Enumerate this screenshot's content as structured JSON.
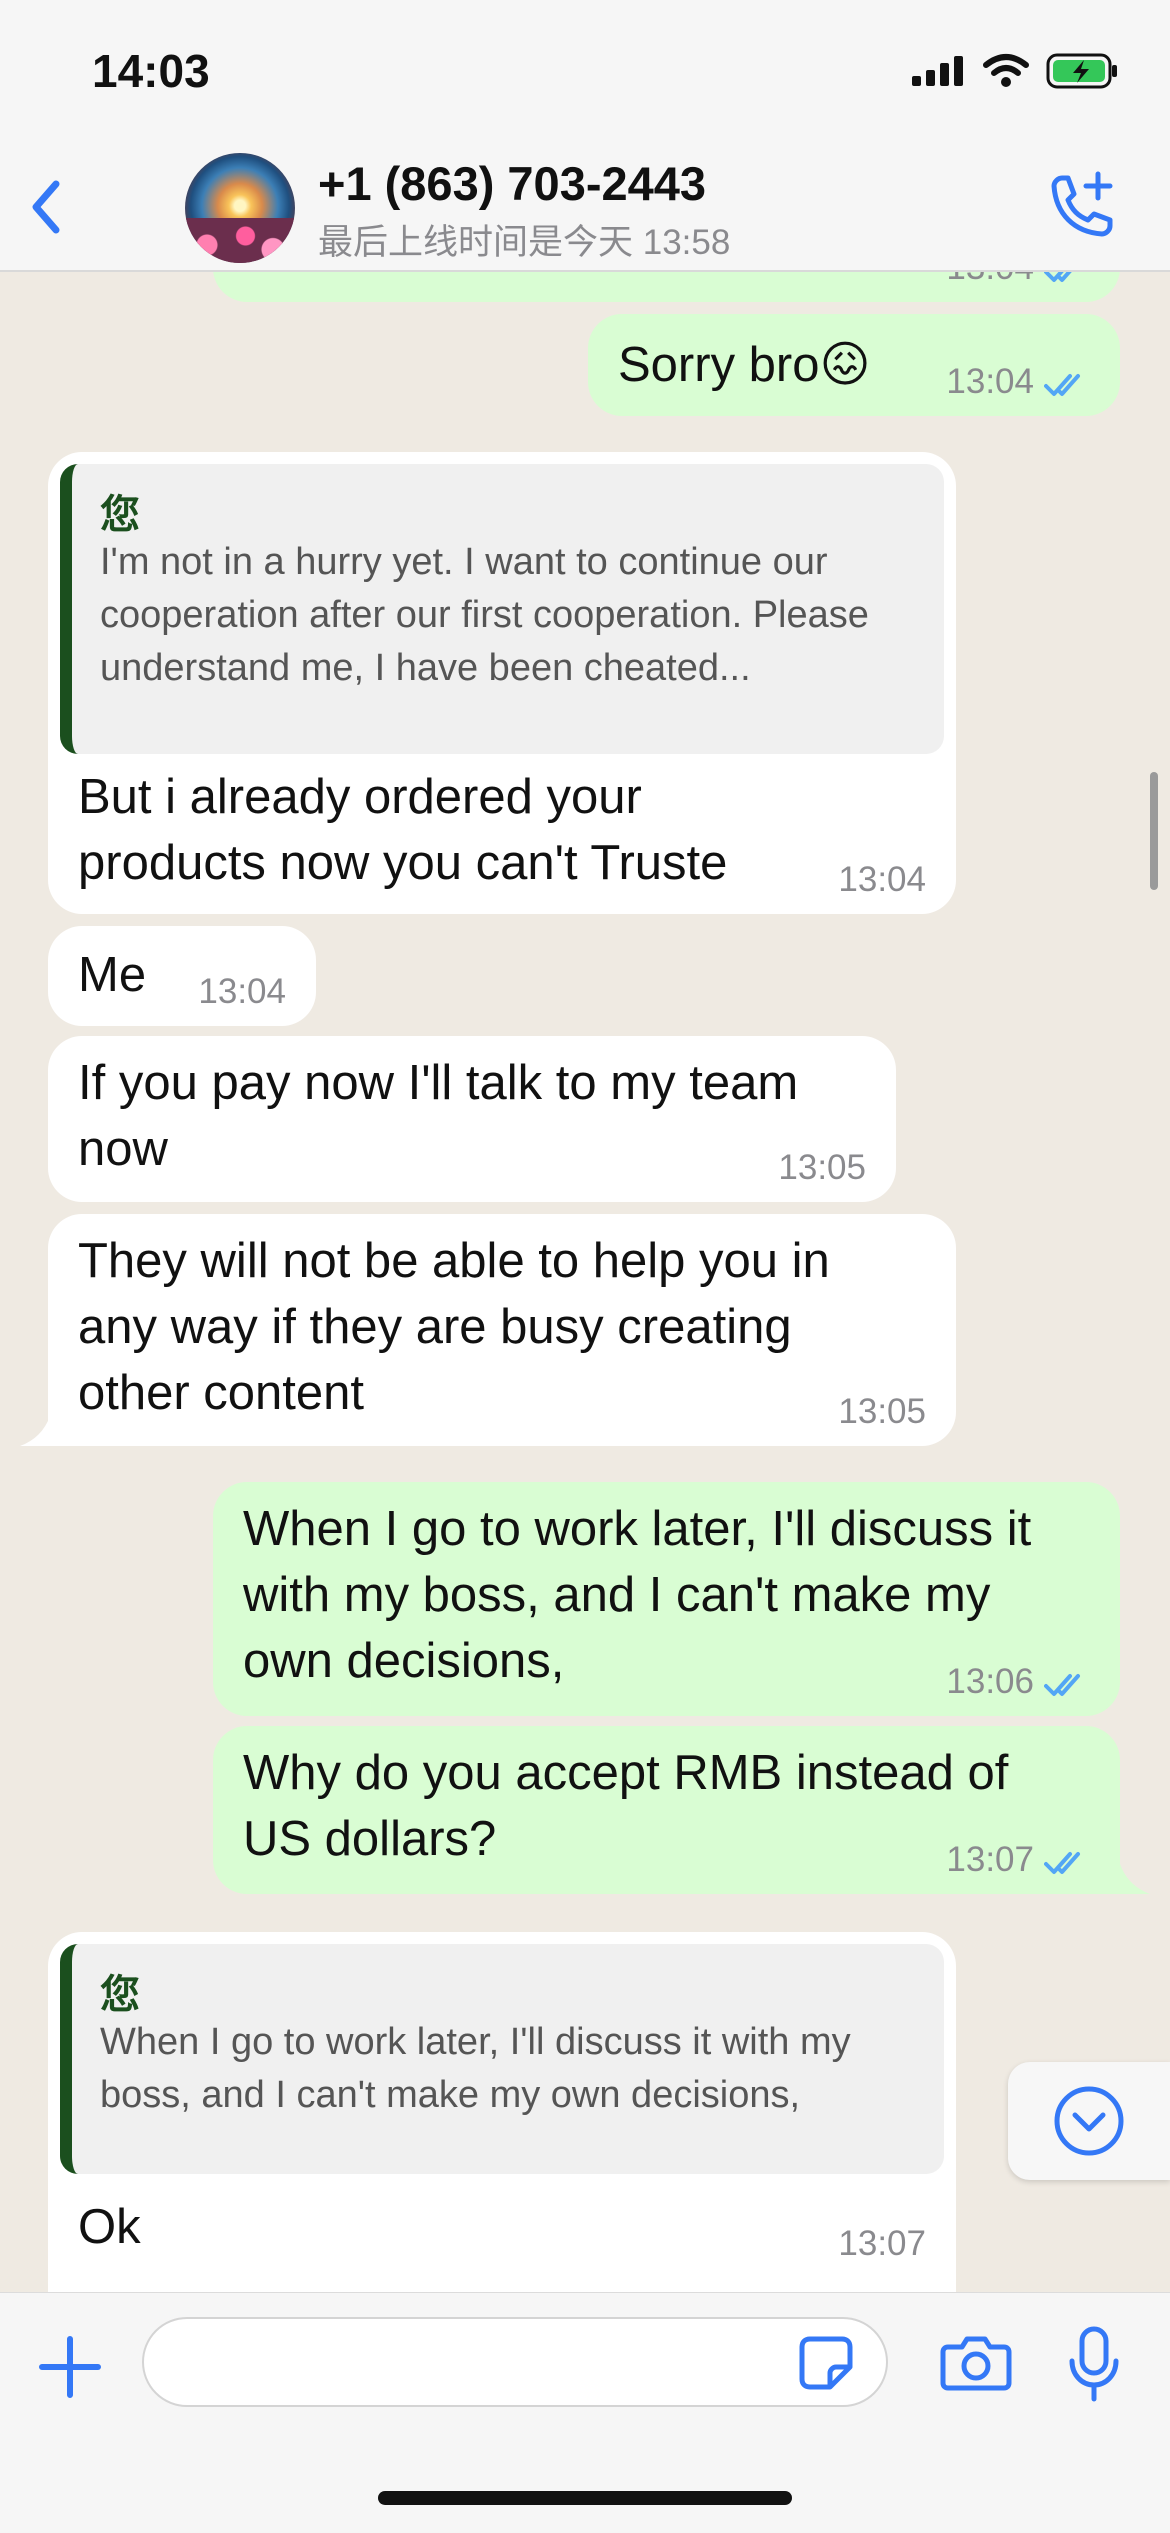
{
  "status_bar": {
    "time": "14:03"
  },
  "header": {
    "contact_name": "+1 (863) 703-2443",
    "last_seen": "最后上线时间是今天 13:58"
  },
  "messages": [
    {
      "direction": "out",
      "text": "",
      "time": "13:04",
      "partial": true
    },
    {
      "direction": "out",
      "text": "Sorry bro😖",
      "time": "13:04"
    },
    {
      "direction": "in",
      "quote": {
        "author": "您",
        "text": "I'm not in a hurry yet. I want to continue our cooperation after our first cooperation. Please understand me, I have been cheated..."
      },
      "text": "But i already ordered your products now you can't Truste",
      "time": "13:04"
    },
    {
      "direction": "in",
      "text": "Me",
      "time": "13:04"
    },
    {
      "direction": "in",
      "text": "If you pay now I'll talk to my team now",
      "time": "13:05"
    },
    {
      "direction": "in",
      "text": "They will not be able to help you in any way if they are busy creating other content",
      "time": "13:05"
    },
    {
      "direction": "out",
      "text": "When I go to work later, I'll discuss it with my boss, and I can't make my own decisions,",
      "time": "13:06"
    },
    {
      "direction": "out",
      "text": "Why do you accept RMB instead of US dollars?",
      "time": "13:07"
    },
    {
      "direction": "in",
      "quote": {
        "author": "您",
        "text": "When I go to work later, I'll discuss it with my boss, and I can't make my own decisions,"
      },
      "text": "Ok",
      "time": "13:07"
    }
  ],
  "input": {
    "placeholder": ""
  },
  "colors": {
    "accent": "#3478f6",
    "out_bubble": "#d9fdd3",
    "in_bubble": "#ffffff",
    "tick": "#53a6f5",
    "quote_bar": "#1b4f1e"
  },
  "icons": [
    "back-icon",
    "call-add-icon",
    "plus-icon",
    "sticker-icon",
    "camera-icon",
    "mic-icon",
    "chevron-down-icon",
    "read-ticks-icon"
  ]
}
